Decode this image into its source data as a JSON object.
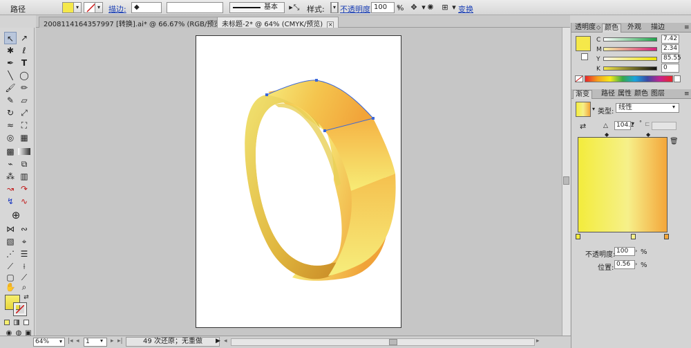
{
  "control_bar": {
    "object_type": "路径",
    "stroke_label": "描边:",
    "stroke_profile": "基本",
    "style_label": "样式:",
    "opacity_label": "不透明度",
    "opacity_value": "100",
    "opacity_unit": "%",
    "transform_label": "变换"
  },
  "doc_tabs": [
    {
      "title": "2008114164357997 [转换].ai* @ 66.67% (RGB/预览)",
      "active": false
    },
    {
      "title": "未标题-2* @ 64% (CMYK/预览)",
      "active": true
    }
  ],
  "status_bar": {
    "zoom": "64%",
    "page": "1",
    "undo_info": "49 次还原；无重做"
  },
  "color_panel": {
    "tabs": [
      "透明度",
      "颜色",
      "外观",
      "描边"
    ],
    "active_tab": "颜色",
    "channels": [
      {
        "name": "C",
        "value": "7.42",
        "color": "#1fa34a"
      },
      {
        "name": "M",
        "value": "2.34",
        "color": "#d4207a"
      },
      {
        "name": "Y",
        "value": "85.55",
        "color": "#f2e500"
      },
      {
        "name": "K",
        "value": "0",
        "color": "#111111"
      }
    ],
    "fill_color": "#f5e84a"
  },
  "gradient_panel": {
    "tabs": [
      "渐变",
      "路径",
      "属性",
      "颜色",
      "图层"
    ],
    "active_tab": "渐变",
    "type_label": "类型:",
    "type_value": "线性",
    "angle": "104.1",
    "angle_unit": "°",
    "opacity_label": "不透明度:",
    "opacity_value": "100",
    "opacity_unit": "%",
    "location_label": "位置:",
    "location_value": "0.56",
    "location_unit": "%",
    "gradient_colors": [
      "#f3ec3c",
      "#f6f08a",
      "#f4a63a"
    ]
  },
  "ring_colors": {
    "gold_light": "#f6ef6e",
    "gold_dark": "#ef9f33",
    "selection": "#3a67d9"
  }
}
